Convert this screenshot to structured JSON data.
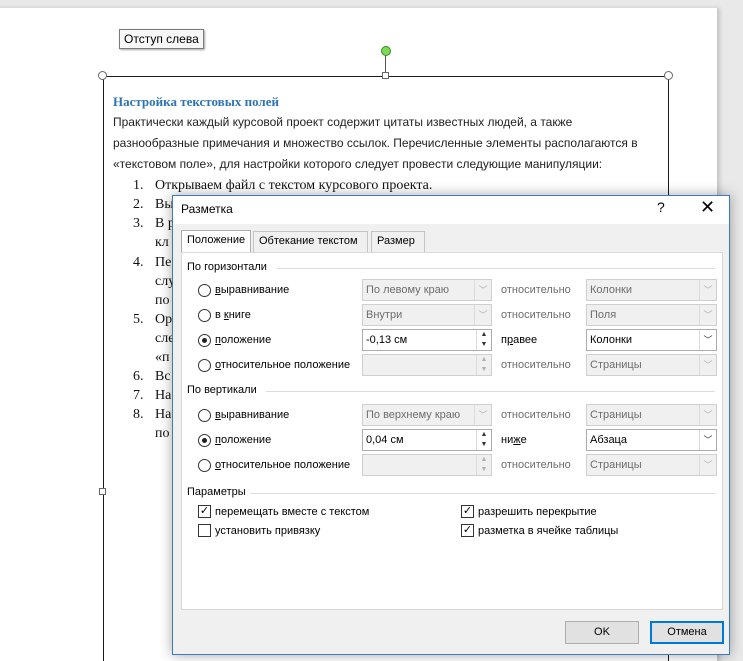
{
  "tooltip": "Отступ слева",
  "document": {
    "heading": "Настройка текстовых полей",
    "paragraph": [
      "Практически каждый курсовой проект содержит цитаты известных людей, а также",
      "разнообразные примечания и множество ссылок. Перечисленные элементы располагаются в",
      "«текстовом поле», для настройки которого следует провести следующие манипуляции:"
    ],
    "list": [
      {
        "num": "1.",
        "text": "Открываем файл с текстом курсового проекта."
      },
      {
        "num": "2.",
        "text": "Вы"
      },
      {
        "num": "3.",
        "text": "В р"
      },
      {
        "num": "",
        "text": "кл"
      },
      {
        "num": "4.",
        "text": "Пе"
      },
      {
        "num": "",
        "text": "слу"
      },
      {
        "num": "",
        "text": "по"
      },
      {
        "num": "5.",
        "text": "Ор"
      },
      {
        "num": "",
        "text": "сле"
      },
      {
        "num": "",
        "text": "«п"
      },
      {
        "num": "6.",
        "text": "Вс"
      },
      {
        "num": "7.",
        "text": "На"
      },
      {
        "num": "8.",
        "text": "На"
      },
      {
        "num": "",
        "text": "по"
      }
    ]
  },
  "dialog": {
    "title": "Разметка",
    "help": "?",
    "close": "✕",
    "tabs": [
      "Положение",
      "Обтекание текстом",
      "Размер"
    ],
    "horizontal": {
      "section": "По горизонтали",
      "rows": [
        {
          "selected": false,
          "label_pre": "",
          "label_u": "в",
          "label_post": "ыравнивание",
          "value": "По левому краю",
          "relword": "относительно",
          "relto": "Колонки",
          "enabled": false,
          "spin": false
        },
        {
          "selected": false,
          "label_pre": "в ",
          "label_u": "к",
          "label_post": "ниге",
          "value": "Внутри",
          "relword": "относительно",
          "relto": "Поля",
          "enabled": false,
          "spin": false
        },
        {
          "selected": true,
          "label_pre": "",
          "label_u": "п",
          "label_post": "оложение",
          "value": "-0,13 см",
          "relword": "правее",
          "relword_u": "р",
          "relto": "Колонки",
          "enabled": true,
          "spin": true
        },
        {
          "selected": false,
          "label_pre": "",
          "label_u": "о",
          "label_post": "тносительное положение",
          "value": "",
          "relword": "относительно",
          "relto": "Страницы",
          "enabled": false,
          "spin": true
        }
      ]
    },
    "vertical": {
      "section": "По вертикали",
      "rows": [
        {
          "selected": false,
          "label_pre": "",
          "label_u": "в",
          "label_post": "ыравнивание",
          "value": "По верхнему краю",
          "relword": "относительно",
          "relto": "Страницы",
          "enabled": false,
          "spin": false
        },
        {
          "selected": true,
          "label_pre": "",
          "label_u": "п",
          "label_post": "оложение",
          "value": "0,04 см",
          "relword": "ниже",
          "relword_u": "ж",
          "relto": "Абзаца",
          "enabled": true,
          "spin": true
        },
        {
          "selected": false,
          "label_pre": "",
          "label_u": "о",
          "label_post": "тносительное положение",
          "value": "",
          "relword": "относительно",
          "relto": "Страницы",
          "enabled": false,
          "spin": true
        }
      ]
    },
    "params": {
      "section": "Параметры",
      "checks": [
        {
          "checked": true,
          "label": "перемещать вместе с текстом"
        },
        {
          "checked": false,
          "label": "установить привязку"
        },
        {
          "checked": true,
          "label": "разрешить перекрытие"
        },
        {
          "checked": true,
          "label": "разметка в ячейке таблицы"
        }
      ]
    },
    "ok": "OK",
    "cancel": "Отмена"
  }
}
